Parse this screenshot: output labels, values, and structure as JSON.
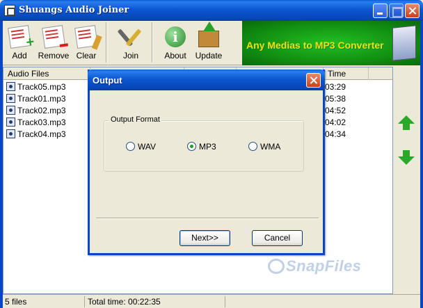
{
  "window": {
    "title": "Shuangs Audio Joiner"
  },
  "toolbar": {
    "add": "Add",
    "remove": "Remove",
    "clear": "Clear",
    "join": "Join",
    "about": "About",
    "update": "Update",
    "banner": "Any Medias to MP3 Converter"
  },
  "list": {
    "headers": {
      "files": "Audio Files",
      "time": "Time"
    },
    "rows": [
      {
        "name": "Track05.mp3",
        "time": "03:29"
      },
      {
        "name": "Track01.mp3",
        "time": "05:38"
      },
      {
        "name": "Track02.mp3",
        "time": "04:52"
      },
      {
        "name": "Track03.mp3",
        "time": "04:02"
      },
      {
        "name": "Track04.mp3",
        "time": "04:34"
      }
    ]
  },
  "status": {
    "files": "5 files",
    "total": "Total time: 00:22:35"
  },
  "watermark": "SnapFiles",
  "dialog": {
    "title": "Output",
    "group_label": "Output Format",
    "options": [
      "WAV",
      "MP3",
      "WMA"
    ],
    "selected": "MP3",
    "next_label": "Next>>",
    "cancel_label": "Cancel"
  },
  "colors": {
    "accent": "#0A5FD8",
    "banner_green": "#129012",
    "banner_text": "#F4E000",
    "arrow_green": "#2AA82A"
  }
}
